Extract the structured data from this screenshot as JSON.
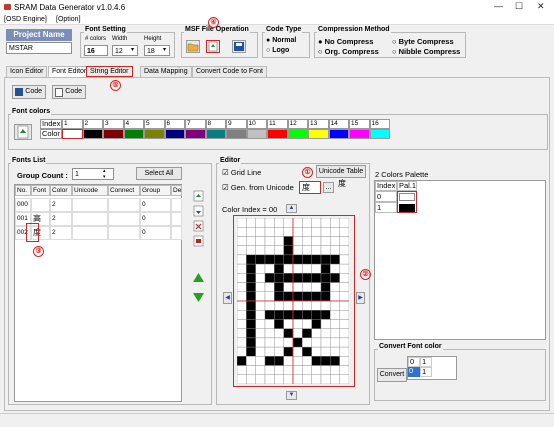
{
  "window": {
    "title": "SRAM Data Generator v1.0.4.6",
    "min": "—",
    "max": "☐",
    "close": "✕"
  },
  "menu": [
    "[OSD Engine]",
    "[Option]"
  ],
  "project": {
    "title": "Project Name",
    "name": "MSTAR"
  },
  "font_setting": {
    "label": "Font Setting",
    "colors_label": "# colors",
    "width_label": "Width",
    "height_label": "Height",
    "colors": "16",
    "width": "12",
    "height": "18"
  },
  "msf": {
    "label": "MSF File Operation"
  },
  "code_type": {
    "label": "Code Type",
    "options": [
      "Normal",
      "Logo"
    ],
    "selected": "Normal"
  },
  "compression": {
    "label": "Compression Method",
    "options": [
      "No Compress",
      "Byte Compress",
      "Org. Compress",
      "Nibble Compress"
    ],
    "selected": "No Compress"
  },
  "tabs": [
    "Icon Editor",
    "Font Editor",
    "String Editor",
    "Data Mapping",
    "Convert Code to Font"
  ],
  "toolbar": {
    "code1": "Code",
    "code2": "Code"
  },
  "font_colors": {
    "label": "Font colors",
    "index_label": "Index",
    "color_label": "Color",
    "indices": [
      "1",
      "2",
      "3",
      "4",
      "5",
      "6",
      "7",
      "8",
      "9",
      "10",
      "11",
      "12",
      "13",
      "14",
      "15",
      "16"
    ],
    "swatches": [
      "#ffffff",
      "#000000",
      "#800000",
      "#008000",
      "#808000",
      "#000080",
      "#800080",
      "#008080",
      "#808080",
      "#c0c0c0",
      "#ff0000",
      "#00ff00",
      "#ffff00",
      "#0000ff",
      "#ff00ff",
      "#00ffff"
    ]
  },
  "fonts_list": {
    "label": "Fonts List",
    "group_count_label": "Group Count :",
    "group_count": "1",
    "select_all": "Select All",
    "columns": [
      "No.",
      "Font",
      "Color",
      "Unicode",
      "Connect",
      "Group",
      "De"
    ],
    "rows": [
      {
        "no": "000",
        "font": "",
        "color": "2",
        "group": "0"
      },
      {
        "no": "001",
        "font": "高",
        "color": "2",
        "group": "0"
      },
      {
        "no": "002",
        "font": "度",
        "color": "2",
        "group": "0"
      }
    ]
  },
  "editor": {
    "label": "Editor",
    "grid_line": "Grid Line",
    "gen_unicode": "Gen. from Unicode",
    "unicode_table": "Unicode Table",
    "unicode_char": "度",
    "preview_char": "度",
    "color_index": "Color Index = 00",
    "browse": "..."
  },
  "palette": {
    "label": "2 Colors Palette",
    "index_label": "Index",
    "pal_label": "Pal.1",
    "rows": [
      "0",
      "1"
    ]
  },
  "convert_color": {
    "label": "Convert Font color",
    "button": "Convert",
    "from": [
      "0",
      "1"
    ],
    "to": [
      "0",
      "1"
    ]
  },
  "annotations": [
    "①",
    "②",
    "③",
    "④",
    "⑤"
  ],
  "icons": [
    "app-logo-icon",
    "open-folder-icon",
    "import-icon",
    "save-icon",
    "add-font-icon",
    "delete-font-icon",
    "arrow-up-icon",
    "arrow-down-icon"
  ],
  "colors": {
    "accent": "#e02020",
    "project_title_bg": "#7b8db8",
    "selected": "#3070d0"
  }
}
